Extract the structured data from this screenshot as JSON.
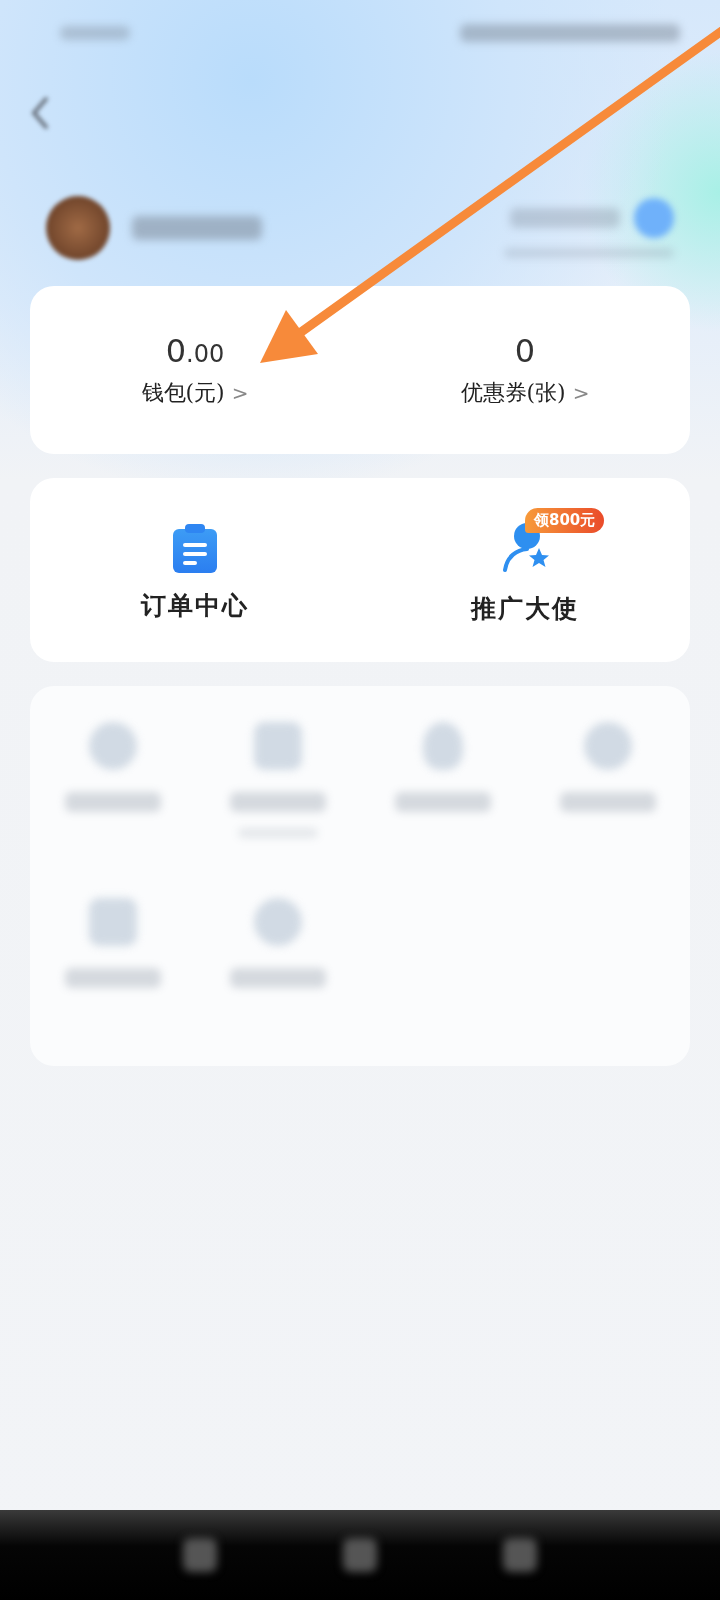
{
  "assets": [
    {
      "value": "0",
      "decimals": ".00",
      "label": "钱包(元)",
      "chevron": ">"
    },
    {
      "value": "0",
      "label": "优惠券(张)",
      "chevron": ">"
    }
  ],
  "shortcuts": [
    {
      "kind": "orders",
      "label": "订单中心"
    },
    {
      "kind": "promoter",
      "label": "推广大使",
      "badge": "领800元"
    }
  ],
  "menu_grid": [
    {
      "kind": "plain"
    },
    {
      "kind": "captioned"
    },
    {
      "kind": "plain"
    },
    {
      "kind": "plain"
    },
    {
      "kind": "plain"
    },
    {
      "kind": "plain"
    }
  ]
}
